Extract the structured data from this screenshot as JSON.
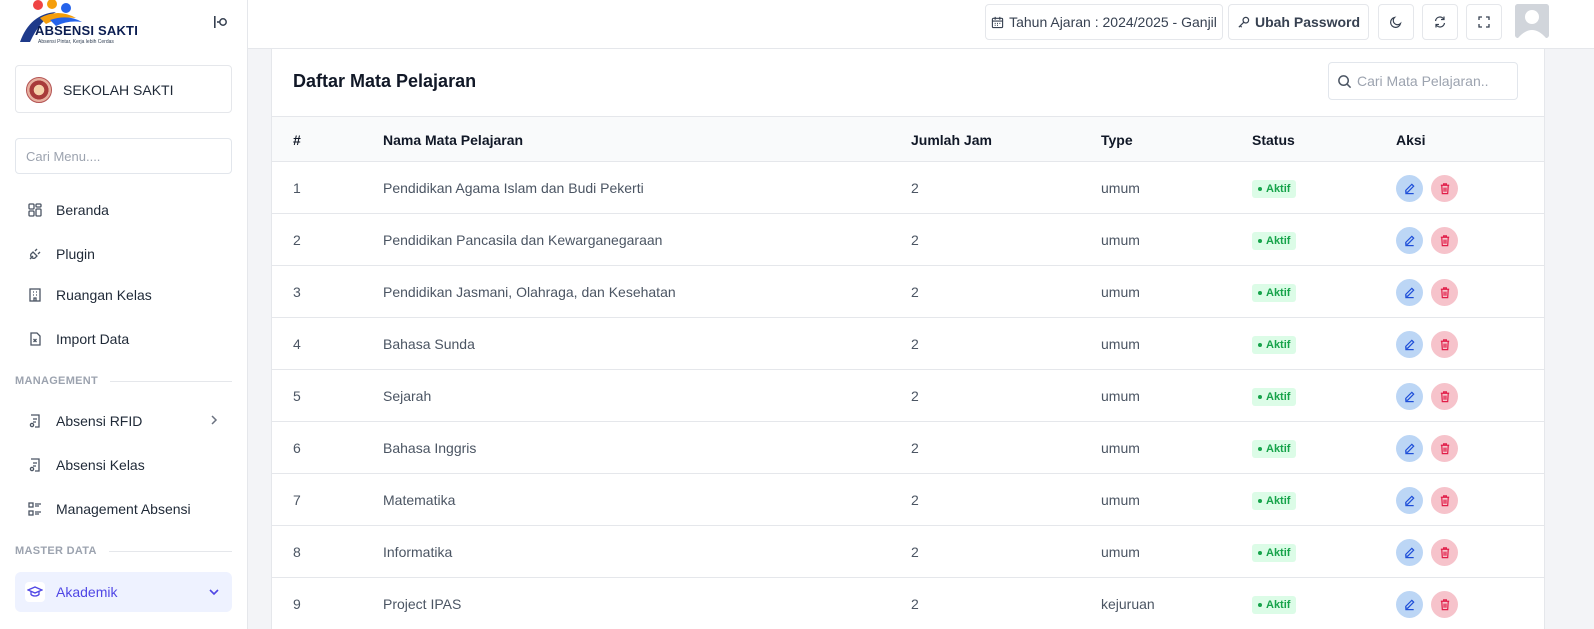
{
  "brand": {
    "name": "ABSENSI SAKTI",
    "tagline": "Absensi Pintar, Kerja lebih Cerdas"
  },
  "school": {
    "name": "SEKOLAH SAKTI"
  },
  "menu_search": {
    "placeholder": "Cari Menu...."
  },
  "nav": {
    "beranda": "Beranda",
    "plugin": "Plugin",
    "ruangan": "Ruangan Kelas",
    "import": "Import Data",
    "section_management": "MANAGEMENT",
    "absensi_rfid": "Absensi RFID",
    "absensi_kelas": "Absensi Kelas",
    "management_absensi": "Management Absensi",
    "section_master": "MASTER DATA",
    "akademik": "Akademik"
  },
  "topbar": {
    "tahun_ajaran": "Tahun Ajaran : 2024/2025 - Ganjil",
    "ubah_password": "Ubah Password"
  },
  "page": {
    "title": "Daftar Mata Pelajaran",
    "search_placeholder": "Cari Mata Pelajaran.."
  },
  "table": {
    "headers": {
      "no": "#",
      "nama": "Nama Mata Pelajaran",
      "jam": "Jumlah Jam",
      "type": "Type",
      "status": "Status",
      "aksi": "Aksi"
    },
    "rows": [
      {
        "no": "1",
        "nama": "Pendidikan Agama Islam dan Budi Pekerti",
        "jam": "2",
        "type": "umum",
        "status": "Aktif"
      },
      {
        "no": "2",
        "nama": "Pendidikan Pancasila dan Kewarganegaraan",
        "jam": "2",
        "type": "umum",
        "status": "Aktif"
      },
      {
        "no": "3",
        "nama": "Pendidikan Jasmani, Olahraga, dan Kesehatan",
        "jam": "2",
        "type": "umum",
        "status": "Aktif"
      },
      {
        "no": "4",
        "nama": "Bahasa Sunda",
        "jam": "2",
        "type": "umum",
        "status": "Aktif"
      },
      {
        "no": "5",
        "nama": "Sejarah",
        "jam": "2",
        "type": "umum",
        "status": "Aktif"
      },
      {
        "no": "6",
        "nama": "Bahasa Inggris",
        "jam": "2",
        "type": "umum",
        "status": "Aktif"
      },
      {
        "no": "7",
        "nama": "Matematika",
        "jam": "2",
        "type": "umum",
        "status": "Aktif"
      },
      {
        "no": "8",
        "nama": "Informatika",
        "jam": "2",
        "type": "umum",
        "status": "Aktif"
      },
      {
        "no": "9",
        "nama": "Project IPAS",
        "jam": "2",
        "type": "kejuruan",
        "status": "Aktif"
      }
    ]
  },
  "colors": {
    "accent": "#4f46e5",
    "status_active": "#16a34a",
    "edit_button": "#bcd6f5",
    "delete_button": "#f6c3cb"
  }
}
